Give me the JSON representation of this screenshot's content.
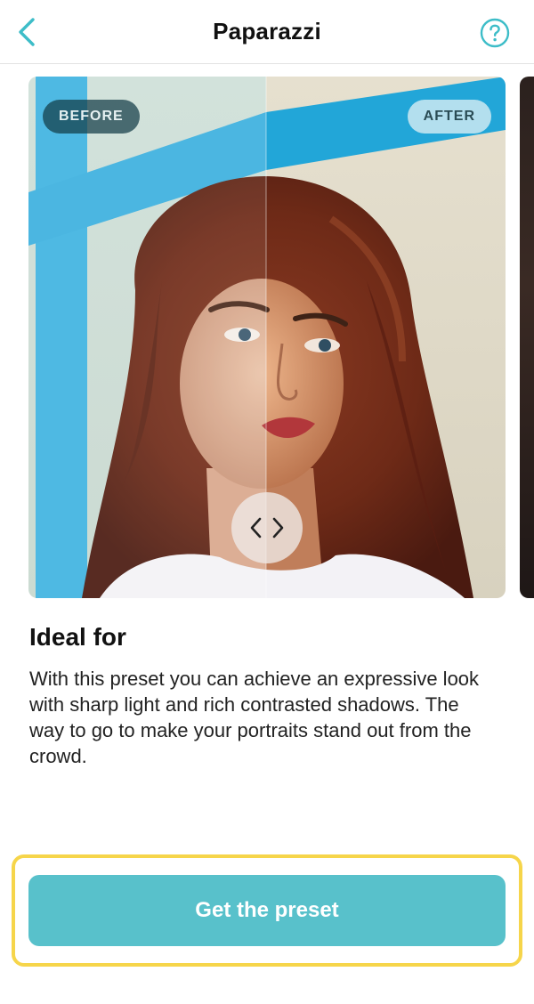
{
  "header": {
    "title": "Paparazzi",
    "back_icon": "chevron-left-icon",
    "help_icon": "question-circle-icon",
    "accent_color": "#3dbdc8"
  },
  "preview": {
    "before_label": "BEFORE",
    "after_label": "AFTER",
    "compare_handle_icon": "compare-arrows-icon"
  },
  "details": {
    "heading": "Ideal for",
    "description": "With this preset you can achieve an expressive look with sharp light and rich contrasted shadows. The way to go to make your portraits stand out from the crowd."
  },
  "cta": {
    "label": "Get the preset",
    "button_color": "#58c1cb",
    "highlight_color": "#f6d54a"
  }
}
